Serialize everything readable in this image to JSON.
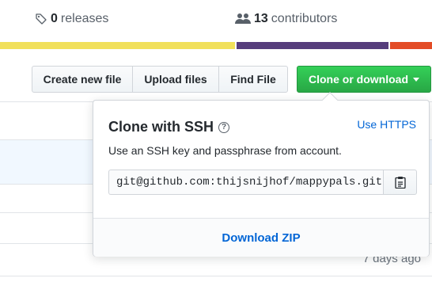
{
  "summary": {
    "releases": {
      "count": "0",
      "label": "releases",
      "icon": "tag-icon"
    },
    "contributors": {
      "count": "13",
      "label": "contributors",
      "icon": "people-icon"
    }
  },
  "language_bar": {
    "segments": [
      {
        "color": "#f1e05a",
        "share": 0.548
      },
      {
        "color": "#563d7c",
        "share": 0.355
      },
      {
        "color": "#e34c26",
        "share": 0.097
      }
    ]
  },
  "toolbar": {
    "create_new_file": "Create new file",
    "upload_files": "Upload files",
    "find_file": "Find File",
    "clone_or_download": "Clone or download"
  },
  "clone_popup": {
    "title": "Clone with SSH",
    "help_icon": "question-icon",
    "use_https": "Use HTTPS",
    "description": "Use an SSH key and passphrase from account.",
    "url_value": "git@github.com:thijsnijhof/mappypals.git",
    "copy_icon": "clipboard-icon",
    "download_zip": "Download ZIP"
  },
  "file_list": {
    "last_time": "7 days ago"
  }
}
